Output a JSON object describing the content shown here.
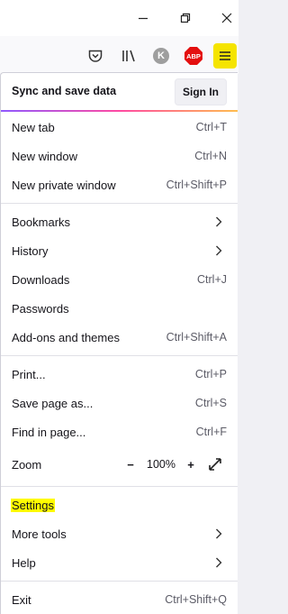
{
  "window": {
    "minimize_icon": "minimize-icon",
    "restore_icon": "restore-icon",
    "close_icon": "close-icon"
  },
  "toolbar": {
    "icons": [
      "pocket-icon",
      "library-icon",
      "k-extension-icon",
      "adblock-plus-icon",
      "hamburger-menu-icon"
    ],
    "k_letter": "K",
    "abp_text": "ABP",
    "highlight_color": "#f5e400"
  },
  "menu": {
    "sync": {
      "label": "Sync and save data",
      "button": "Sign In"
    },
    "items": {
      "new_tab": {
        "label": "New tab",
        "shortcut": "Ctrl+T"
      },
      "new_window": {
        "label": "New window",
        "shortcut": "Ctrl+N"
      },
      "new_private": {
        "label": "New private window",
        "shortcut": "Ctrl+Shift+P"
      },
      "bookmarks": {
        "label": "Bookmarks"
      },
      "history": {
        "label": "History"
      },
      "downloads": {
        "label": "Downloads",
        "shortcut": "Ctrl+J"
      },
      "passwords": {
        "label": "Passwords"
      },
      "addons": {
        "label": "Add-ons and themes",
        "shortcut": "Ctrl+Shift+A"
      },
      "print": {
        "label": "Print...",
        "shortcut": "Ctrl+P"
      },
      "save_page": {
        "label": "Save page as...",
        "shortcut": "Ctrl+S"
      },
      "find": {
        "label": "Find in page...",
        "shortcut": "Ctrl+F"
      },
      "zoom": {
        "label": "Zoom",
        "minus": "−",
        "value": "100%",
        "plus": "+"
      },
      "settings": {
        "label": "Settings"
      },
      "more_tools": {
        "label": "More tools"
      },
      "help": {
        "label": "Help"
      },
      "exit": {
        "label": "Exit",
        "shortcut": "Ctrl+Shift+Q"
      }
    }
  }
}
